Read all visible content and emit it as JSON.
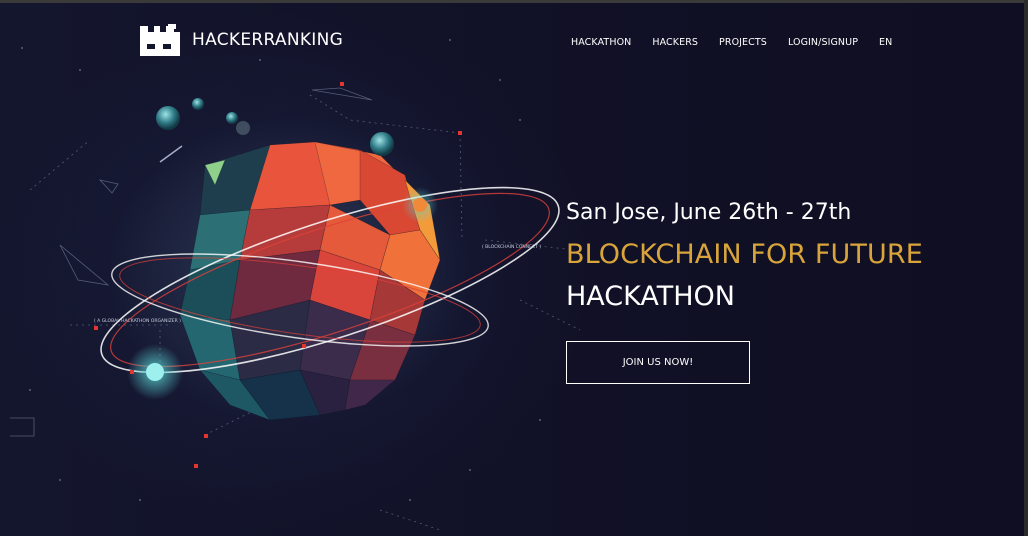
{
  "brand": {
    "name": "HACKERRANKING",
    "logo_icon": "castle-icon"
  },
  "nav": {
    "items": [
      {
        "label": "HACKATHON"
      },
      {
        "label": "HACKERS"
      },
      {
        "label": "PROJECTS"
      },
      {
        "label": "LOGIN/SIGNUP"
      },
      {
        "label": "EN"
      }
    ]
  },
  "hero": {
    "event_date": "San Jose, June 26th - 27th",
    "headline_1": "BLOCKCHAIN FOR FUTURE",
    "headline_2": "HACKATHON",
    "cta_label": "JOIN US NOW!",
    "art_label_1": "( BLOCKCHAIN CONNECT )",
    "art_label_2": "( A GLOBAL HACKATHON ORGANIZER )"
  },
  "colors": {
    "background": "#0f0e22",
    "accent": "#d9a53b",
    "text": "#ffffff"
  }
}
